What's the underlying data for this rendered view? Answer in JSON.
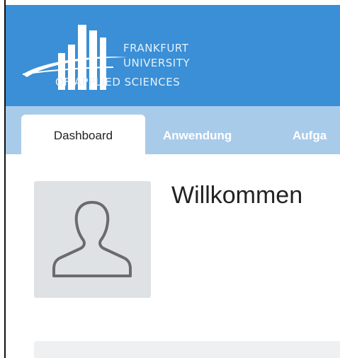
{
  "brand": {
    "line1": "FRANKFURT",
    "line2": "UNIVERSITY",
    "line3": "OF APPLIED SCIENCES",
    "header_color": "#3a8fd6"
  },
  "tabs": [
    {
      "label": "Dashboard",
      "active": true
    },
    {
      "label": "Anwendung",
      "active": false
    },
    {
      "label": "Aufga",
      "active": false
    }
  ],
  "profile": {
    "avatar_icon": "user-silhouette-icon"
  },
  "main": {
    "welcome_text": "Willkommen"
  }
}
